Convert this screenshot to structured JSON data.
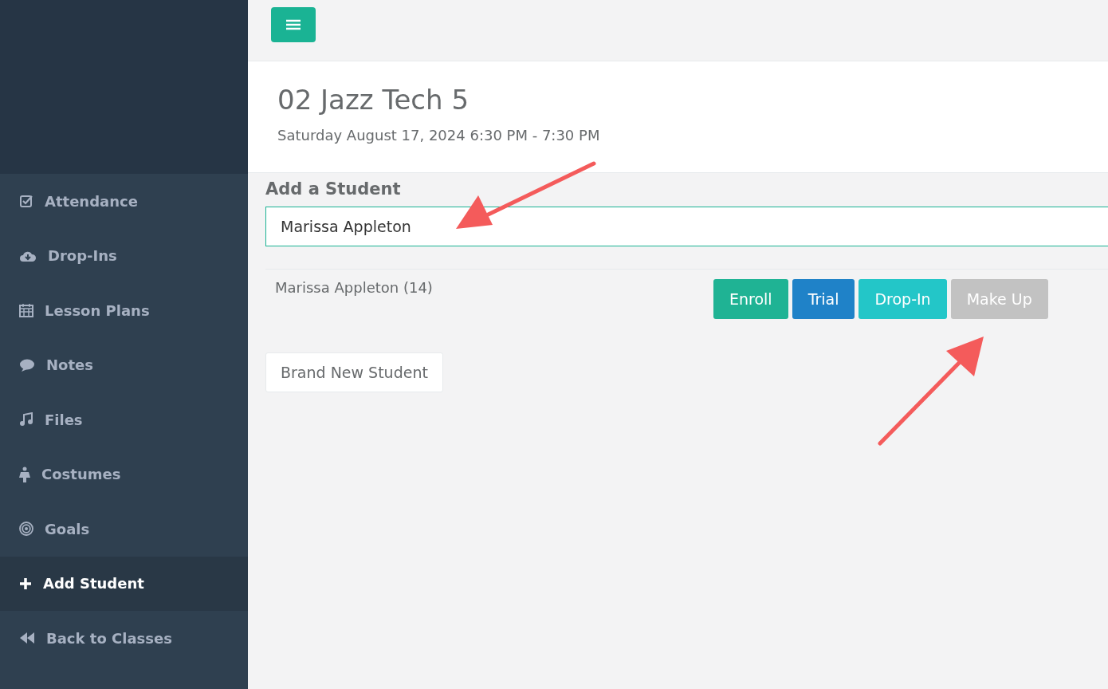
{
  "sidebar": {
    "items": [
      {
        "label": "Attendance",
        "selected": false
      },
      {
        "label": "Drop-Ins",
        "selected": false
      },
      {
        "label": "Lesson Plans",
        "selected": false
      },
      {
        "label": "Notes",
        "selected": false
      },
      {
        "label": "Files",
        "selected": false
      },
      {
        "label": "Costumes",
        "selected": false
      },
      {
        "label": "Goals",
        "selected": false
      },
      {
        "label": "Add Student",
        "selected": true
      },
      {
        "label": "Back to Classes",
        "selected": false
      }
    ]
  },
  "header": {
    "title": "02 Jazz Tech 5",
    "subtitle": "Saturday August 17, 2024 6:30 PM - 7:30 PM"
  },
  "add_student": {
    "heading": "Add a Student",
    "search": {
      "value": "Marissa Appleton"
    },
    "results": [
      {
        "name": "Marissa Appleton (14)",
        "buttons": [
          {
            "label": "Enroll",
            "color": "#1fb394"
          },
          {
            "label": "Trial",
            "color": "#1f82c8"
          },
          {
            "label": "Drop-In",
            "color": "#23c6c8"
          },
          {
            "label": "Make Up",
            "color": "#c2c2c2"
          }
        ]
      }
    ],
    "new_button": "Brand New Student"
  }
}
